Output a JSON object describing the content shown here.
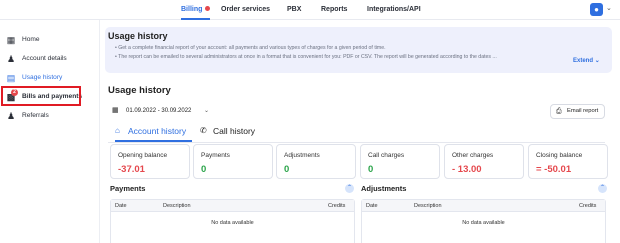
{
  "topnav": {
    "tabs": [
      {
        "label": "Billing"
      },
      {
        "label": "Order services"
      },
      {
        "label": "PBX"
      },
      {
        "label": "Reports"
      },
      {
        "label": "Integrations/API"
      }
    ],
    "user_chevron": "⌄"
  },
  "sidebar": {
    "items": [
      {
        "label": "Home",
        "icon": "dashboard-icon"
      },
      {
        "label": "Account details",
        "icon": "person-icon"
      },
      {
        "label": "Usage history",
        "icon": "document-icon"
      },
      {
        "label": "Bills and payments",
        "icon": "wallet-icon",
        "badge": "2"
      },
      {
        "label": "Referrals",
        "icon": "people-icon"
      }
    ]
  },
  "banner": {
    "title": "Usage history",
    "line1": "• Get a complete financial report of your account: all payments and various types of charges for a given period of time.",
    "line2": "• The report can be emailed to several administrators at once in a format that is convenient for you: PDF or CSV. The report will be generated according to the dates ...",
    "extend_label": "Extend"
  },
  "main": {
    "title": "Usage history",
    "date_range": "01.09.2022 - 30.09.2022",
    "email_report_label": "Email report",
    "subtabs": [
      {
        "label": "Account history"
      },
      {
        "label": "Call history"
      }
    ]
  },
  "cards": [
    {
      "label": "Opening balance",
      "value": "-37.01"
    },
    {
      "label": "Payments",
      "value": "0"
    },
    {
      "label": "Adjustments",
      "value": "0"
    },
    {
      "label": "Call charges",
      "value": "0"
    },
    {
      "label": "Other charges",
      "value": "- 13.00"
    },
    {
      "label": "Closing balance",
      "value": "= -50.01"
    }
  ],
  "payments": {
    "title": "Payments",
    "columns": [
      "Date",
      "Description",
      "Credits"
    ],
    "empty_text": "No data available"
  },
  "adjustments": {
    "title": "Adjustments",
    "columns": [
      "Date",
      "Description",
      "Credits"
    ],
    "empty_text": "No data available"
  },
  "colors": {
    "accent": "#2f6fe0",
    "negative": "#e5484d",
    "positive": "#2ba44a",
    "highlight_box": "#e01b24"
  }
}
